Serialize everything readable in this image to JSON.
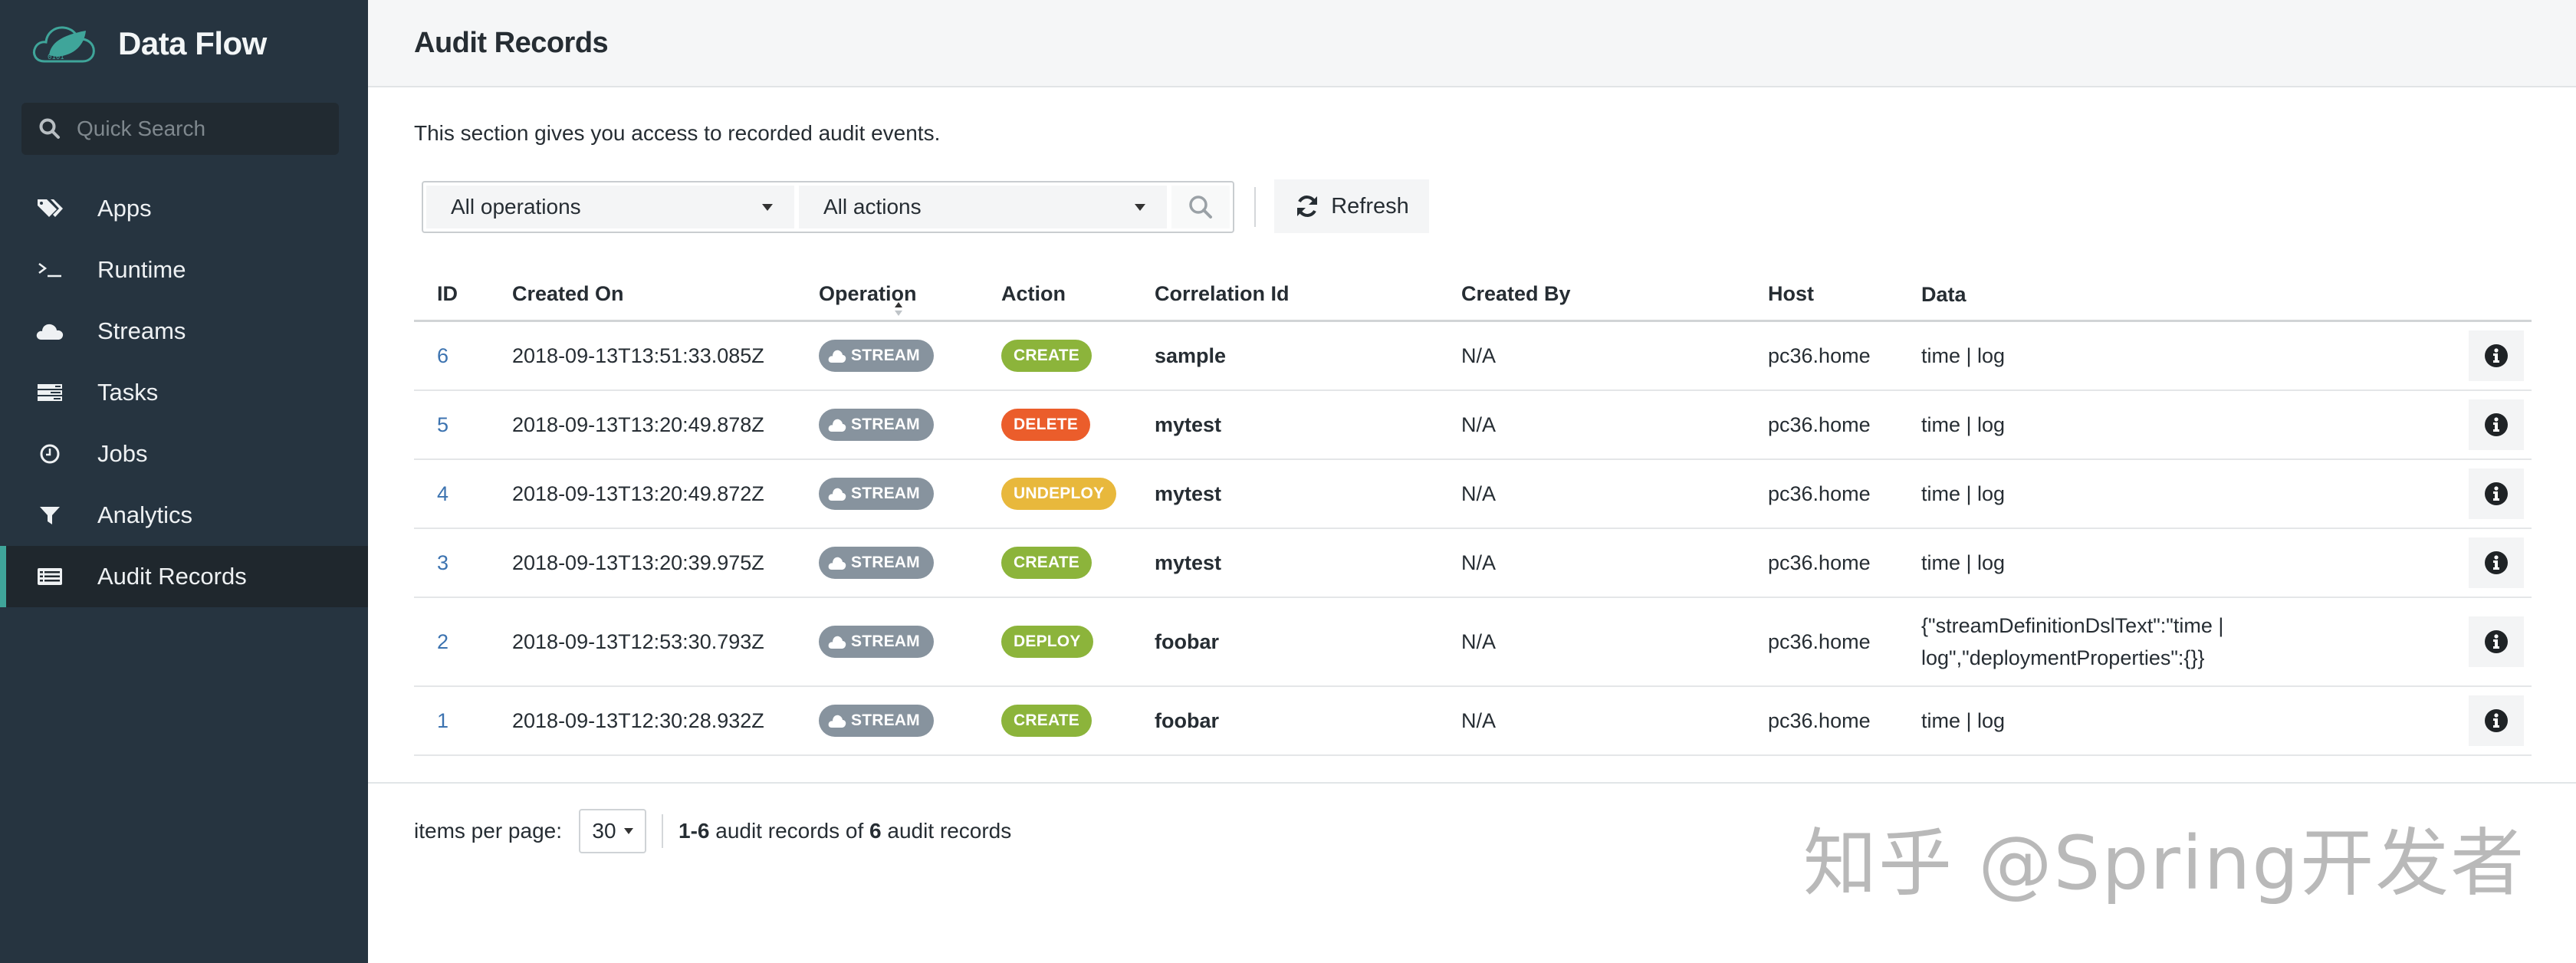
{
  "app": {
    "title": "Data Flow",
    "search_placeholder": "Quick Search"
  },
  "sidebar": {
    "items": [
      {
        "label": "Apps",
        "icon": "tags-icon",
        "active": false
      },
      {
        "label": "Runtime",
        "icon": "terminal-icon",
        "active": false
      },
      {
        "label": "Streams",
        "icon": "cloud-icon",
        "active": false
      },
      {
        "label": "Tasks",
        "icon": "tasks-icon",
        "active": false
      },
      {
        "label": "Jobs",
        "icon": "clock-icon",
        "active": false
      },
      {
        "label": "Analytics",
        "icon": "filter-icon",
        "active": false
      },
      {
        "label": "Audit Records",
        "icon": "list-alt-icon",
        "active": true
      }
    ]
  },
  "page": {
    "title": "Audit Records",
    "description": "This section gives you access to recorded audit events."
  },
  "filters": {
    "operation_selected": "All operations",
    "action_selected": "All actions",
    "refresh_label": "Refresh"
  },
  "table": {
    "columns": [
      "ID",
      "Created On",
      "Operation",
      "Action",
      "Correlation Id",
      "Created By",
      "Host",
      "Data"
    ],
    "sort": {
      "column": "Created On",
      "direction": "ascending"
    },
    "rows": [
      {
        "id": "6",
        "created_on": "2018-09-13T13:51:33.085Z",
        "operation": "STREAM",
        "action": "CREATE",
        "action_color": "#8cb43b",
        "correlation_id": "sample",
        "created_by": "N/A",
        "host": "pc36.home",
        "data": "time | log"
      },
      {
        "id": "5",
        "created_on": "2018-09-13T13:20:49.878Z",
        "operation": "STREAM",
        "action": "DELETE",
        "action_color": "#eb5d2b",
        "correlation_id": "mytest",
        "created_by": "N/A",
        "host": "pc36.home",
        "data": "time | log"
      },
      {
        "id": "4",
        "created_on": "2018-09-13T13:20:49.872Z",
        "operation": "STREAM",
        "action": "UNDEPLOY",
        "action_color": "#e8b83c",
        "correlation_id": "mytest",
        "created_by": "N/A",
        "host": "pc36.home",
        "data": "time | log"
      },
      {
        "id": "3",
        "created_on": "2018-09-13T13:20:39.975Z",
        "operation": "STREAM",
        "action": "CREATE",
        "action_color": "#8cb43b",
        "correlation_id": "mytest",
        "created_by": "N/A",
        "host": "pc36.home",
        "data": "time | log"
      },
      {
        "id": "2",
        "created_on": "2018-09-13T12:53:30.793Z",
        "operation": "STREAM",
        "action": "DEPLOY",
        "action_color": "#8cb43b",
        "correlation_id": "foobar",
        "created_by": "N/A",
        "host": "pc36.home",
        "data": "{\"streamDefinitionDslText\":\"time | log\",\"deploymentProperties\":{}}"
      },
      {
        "id": "1",
        "created_on": "2018-09-13T12:30:28.932Z",
        "operation": "STREAM",
        "action": "CREATE",
        "action_color": "#8cb43b",
        "correlation_id": "foobar",
        "created_by": "N/A",
        "host": "pc36.home",
        "data": "time | log"
      }
    ]
  },
  "pagination": {
    "items_per_page_label": "items per page:",
    "items_per_page": "30",
    "range": "1-6",
    "range_suffix": " audit records of ",
    "total": "6",
    "total_suffix": " audit records"
  },
  "watermark": "知乎 @Spring开发者",
  "colors": {
    "sidebar_bg": "#263440",
    "accent": "#3fa59a",
    "link": "#3c73b0",
    "operation_badge": "#87939e"
  }
}
